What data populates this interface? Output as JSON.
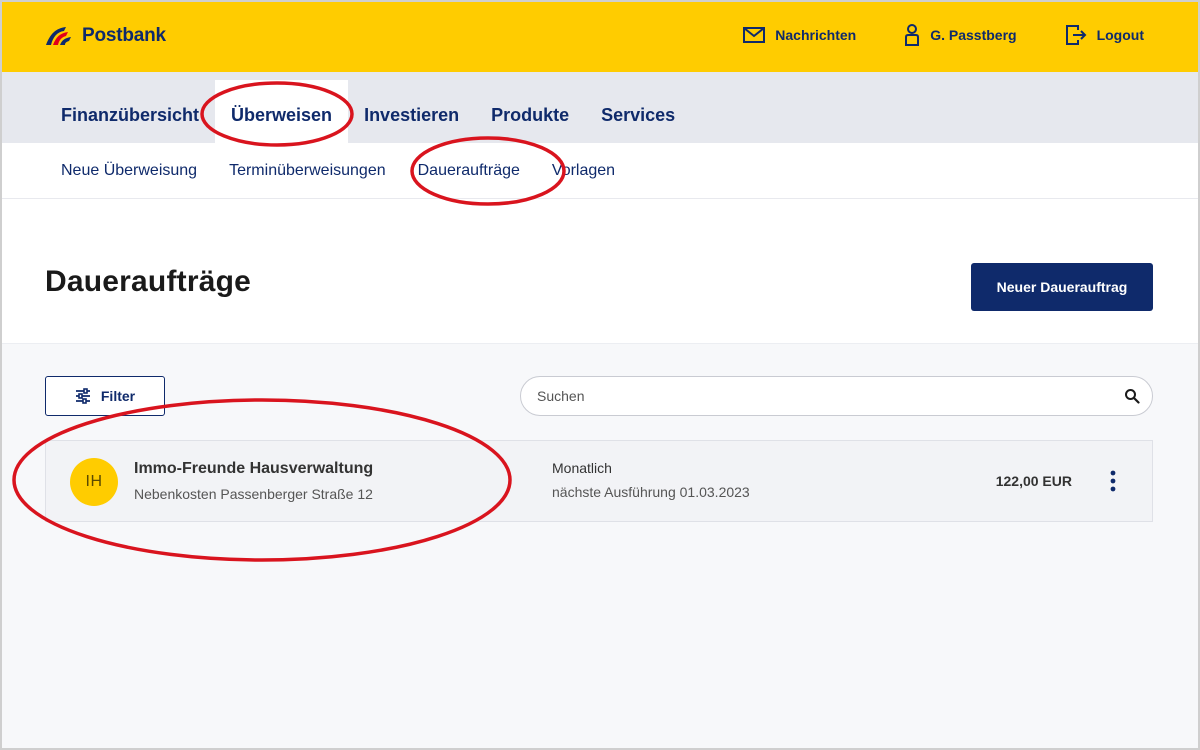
{
  "brand": {
    "name": "Postbank",
    "color": "#ffcc00",
    "accent": "#0f2a6b"
  },
  "header": {
    "actions": [
      {
        "icon": "envelope-icon",
        "label": "Nachrichten"
      },
      {
        "icon": "user-icon",
        "label": "G. Passtberg"
      },
      {
        "icon": "logout-icon",
        "label": "Logout"
      }
    ]
  },
  "mainnav": {
    "items": [
      "Finanzübersicht",
      "Überweisen",
      "Investieren",
      "Produkte",
      "Services"
    ],
    "active": "Überweisen"
  },
  "subnav": {
    "items": [
      "Neue Überweisung",
      "Terminüberweisungen",
      "Daueraufträge",
      "Vorlagen"
    ],
    "active": "Daueraufträge"
  },
  "page": {
    "title": "Daueraufträge",
    "primary_button": "Neuer Dauerauftrag"
  },
  "toolbar": {
    "filter_label": "Filter",
    "search_placeholder": "Suchen"
  },
  "orders": [
    {
      "initials": "IH",
      "payee": "Immo-Freunde Hausverwaltung",
      "purpose": "Nebenkosten Passenberger Straße 12",
      "frequency": "Monatlich",
      "next_execution": "nächste Ausführung 01.03.2023",
      "amount": "122,00 EUR"
    }
  ],
  "annotation_color": "#d9141e"
}
